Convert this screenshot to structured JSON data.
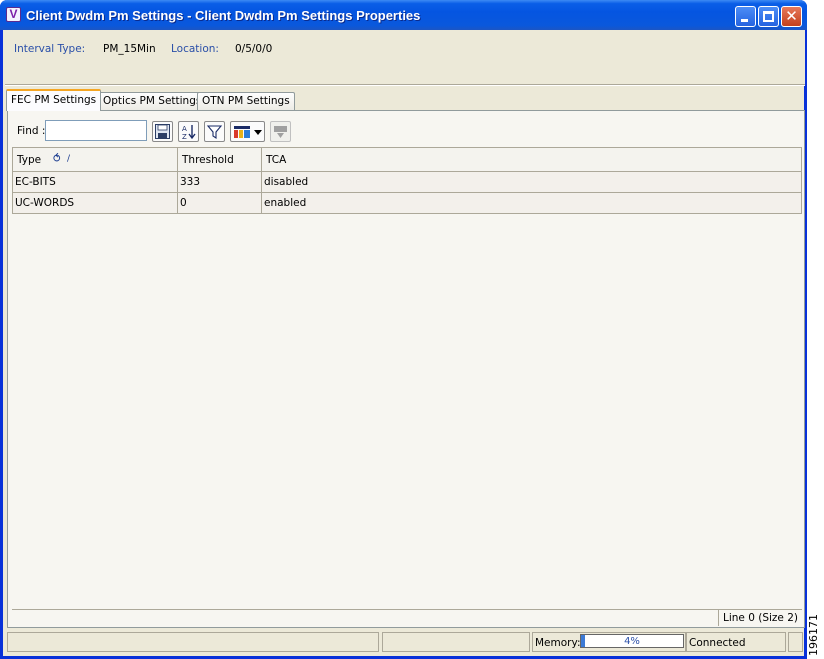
{
  "window": {
    "title": "Client Dwdm Pm Settings - Client Dwdm Pm Settings Properties",
    "app_icon_letter": "V"
  },
  "info": {
    "interval_type_label": "Interval Type:",
    "interval_type_value": "PM_15Min",
    "location_label": "Location:",
    "location_value": "0/5/0/0"
  },
  "tabs": [
    {
      "label": "FEC PM Settings",
      "active": true
    },
    {
      "label": "Optics PM Settings",
      "active": false
    },
    {
      "label": "OTN PM Settings",
      "active": false
    }
  ],
  "toolbar": {
    "find_label": "Find :",
    "find_value": ""
  },
  "table": {
    "columns": [
      "Type",
      "Threshold",
      "TCA"
    ],
    "sort_indicator": "/",
    "rows": [
      [
        "EC-BITS",
        "333",
        "disabled"
      ],
      [
        "UC-WORDS",
        "0",
        "enabled"
      ]
    ],
    "line_info": "Line 0 (Size 2)"
  },
  "statusbar": {
    "memory_label": "Memory:",
    "memory_value": "4%",
    "memory_fraction": 0.04,
    "connection_status": "Connected"
  },
  "side_label": "196171"
}
